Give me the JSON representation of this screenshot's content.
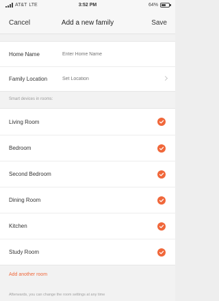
{
  "status_bar": {
    "carrier": "AT&T",
    "network": "LTE",
    "time": "3:52 PM",
    "battery": "64%",
    "battery_level": 0.64
  },
  "nav": {
    "cancel_label": "Cancel",
    "title": "Add a new family",
    "save_label": "Save"
  },
  "form": {
    "home_name": {
      "label": "Home Name",
      "placeholder": "Enter Home Name",
      "value": ""
    },
    "family_location": {
      "label": "Family Location",
      "placeholder": "Set Location",
      "value": ""
    }
  },
  "rooms_section": {
    "header": "Smart devices in rooms:",
    "rooms": [
      {
        "label": "Living Room",
        "checked": true
      },
      {
        "label": "Bedroom",
        "checked": true
      },
      {
        "label": "Second Bedroom",
        "checked": true
      },
      {
        "label": "Dining Room",
        "checked": true
      },
      {
        "label": "Kitchen",
        "checked": true
      },
      {
        "label": "Study Room",
        "checked": true
      }
    ]
  },
  "add_room_label": "Add another room",
  "footer_note": "Afterwards, you can change the room settings at any time",
  "colors": {
    "accent": "#f0673a",
    "background": "#f2f2f2",
    "surface": "#ffffff"
  },
  "icons": {
    "check": "check-icon",
    "chevron": "chevron-right-icon"
  }
}
